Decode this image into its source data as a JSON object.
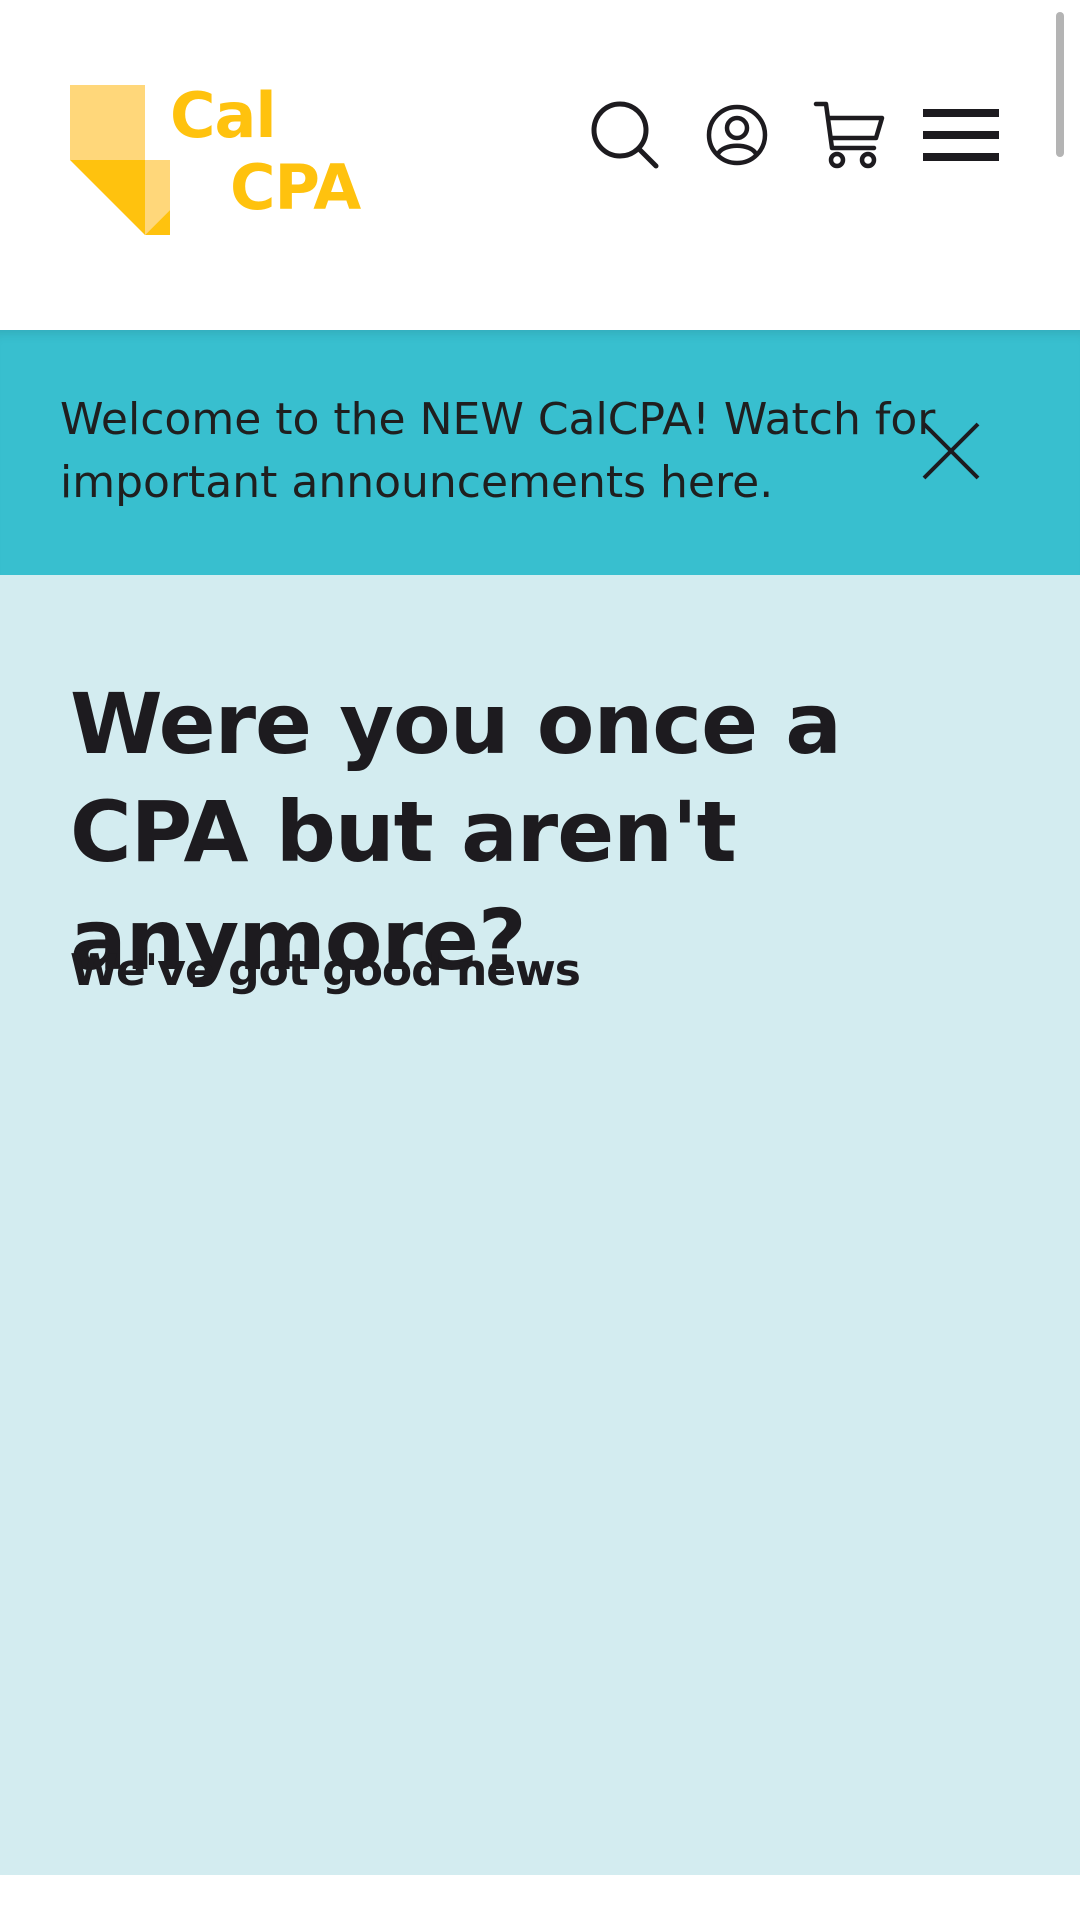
{
  "header": {
    "logo": {
      "line1": "Cal",
      "line2": "CPA",
      "colors": {
        "text": "#ffc20e",
        "light": "#ffd77a",
        "dark": "#ffc20e"
      }
    },
    "actions": [
      {
        "icon": "search-icon"
      },
      {
        "icon": "account-icon"
      },
      {
        "icon": "cart-icon"
      },
      {
        "icon": "menu-icon"
      }
    ]
  },
  "announcement": {
    "text": "Welcome to the NEW CalCPA! Watch for important announcements here.",
    "close_icon": "close-icon",
    "background": "#38bfcf"
  },
  "hero": {
    "title": "Were you once a CPA but aren't anymore?",
    "subtitle": "We've got good news",
    "background": "#d3ecf0"
  }
}
